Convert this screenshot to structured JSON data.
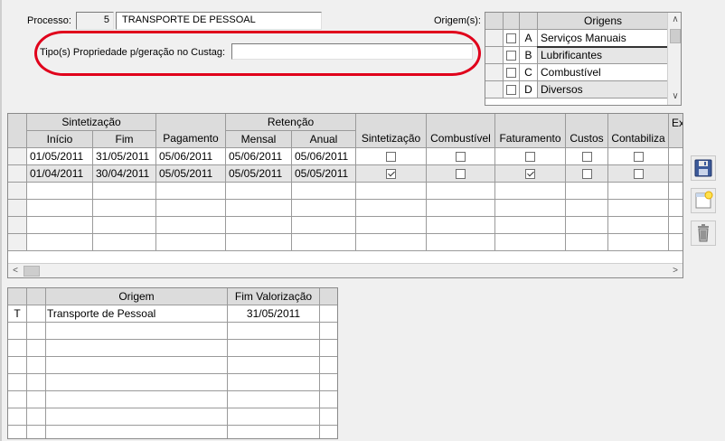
{
  "header": {
    "processo_label": "Processo:",
    "processo_num": "5",
    "processo_name": "TRANSPORTE DE PESSOAL",
    "tipo_label": "Tipo(s) Propriedade p/geração no Custag:",
    "tipo_value": "",
    "origens_label": "Origem(s):"
  },
  "origens_list": {
    "header": "Origens",
    "items": [
      {
        "code": "A",
        "name": "Serviços Manuais",
        "checked": false
      },
      {
        "code": "B",
        "name": "Lubrificantes",
        "checked": false
      },
      {
        "code": "C",
        "name": "Combustível",
        "checked": false
      },
      {
        "code": "D",
        "name": "Diversos",
        "checked": false
      }
    ]
  },
  "main_grid": {
    "group_sintetizacao": "Sintetização",
    "group_retencao": "Retenção",
    "col_inicio": "Início",
    "col_fim": "Fim",
    "col_pagamento": "Pagamento",
    "col_mensal": "Mensal",
    "col_anual": "Anual",
    "col_sintetizacao": "Sintetização",
    "col_combustivel": "Combustível",
    "col_faturamento": "Faturamento",
    "col_custos": "Custos",
    "col_contabiliza": "Contabiliza",
    "col_extra": "Ex",
    "rows": [
      {
        "inicio": "01/05/2011",
        "fim": "31/05/2011",
        "pagamento": "05/06/2011",
        "mensal": "05/06/2011",
        "anual": "05/06/2011",
        "sint": false,
        "comb": false,
        "fat": false,
        "cust": false,
        "cont": false
      },
      {
        "inicio": "01/04/2011",
        "fim": "30/04/2011",
        "pagamento": "05/05/2011",
        "mensal": "05/05/2011",
        "anual": "05/05/2011",
        "sint": true,
        "comb": false,
        "fat": true,
        "cust": false,
        "cont": false
      }
    ]
  },
  "bottom_grid": {
    "col_origem": "Origem",
    "col_fim_valorizacao": "Fim Valorização",
    "rows": [
      {
        "code": "T",
        "origem": "Transporte de Pessoal",
        "fim": "31/05/2011"
      }
    ]
  },
  "toolbar": {
    "save_icon": "floppy-disk-icon",
    "new_icon": "new-document-icon",
    "delete_icon": "trash-icon"
  },
  "colors": {
    "highlight_oval": "#e0001b",
    "header_bg": "#dcdcdc",
    "selected_row": "#e6e6e6"
  }
}
